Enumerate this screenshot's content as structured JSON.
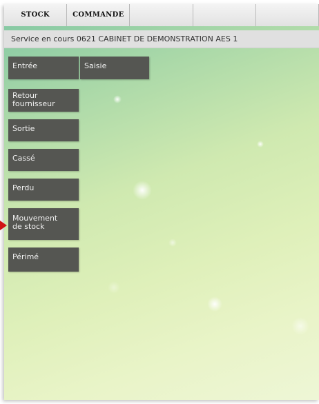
{
  "tabs": [
    {
      "label": "STOCK"
    },
    {
      "label": "COMMANDE"
    },
    {
      "label": ""
    },
    {
      "label": ""
    },
    {
      "label": ""
    }
  ],
  "service": {
    "text": "Service en cours 0621 CABINET DE DEMONSTRATION AES 1"
  },
  "menu": {
    "entree": "Entrée",
    "saisie": "Saisie",
    "retour_fournisseur": "Retour\nfournisseur",
    "sortie": "Sortie",
    "casse": "Cassé",
    "perdu": "Perdu",
    "mouvement_de_stock": "Mouvement\nde stock",
    "perime": "Périmé"
  },
  "colors": {
    "button_bg": "#555652",
    "button_text": "#f0f0f0",
    "pointer": "#d11414"
  }
}
